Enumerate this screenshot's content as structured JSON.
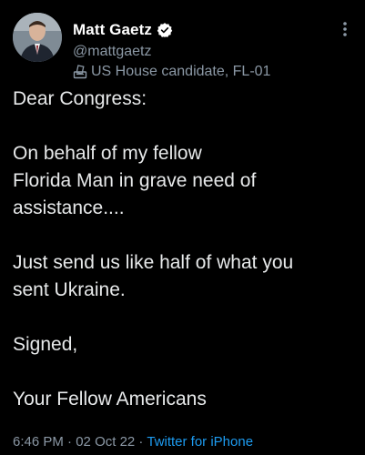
{
  "author": {
    "display_name": "Matt Gaetz",
    "handle": "@mattgaetz",
    "label": "US House candidate, FL-01",
    "verified_icon": "verified-badge-icon",
    "label_icon": "ballot-box-icon"
  },
  "tweet": {
    "paragraphs": [
      "Dear Congress:",
      "On behalf of my fellow\nFlorida Man in grave need of\nassistance....",
      "Just send us like half of what you\nsent Ukraine.",
      "Signed,",
      "Your Fellow Americans"
    ]
  },
  "meta": {
    "time": "6:46 PM",
    "separator1": " · ",
    "date": "02 Oct 22",
    "separator2": " · ",
    "source": "Twitter for iPhone"
  },
  "colors": {
    "background": "#000000",
    "text": "#e7e9ea",
    "muted": "#8b98a5",
    "accent": "#1d9bf0"
  }
}
